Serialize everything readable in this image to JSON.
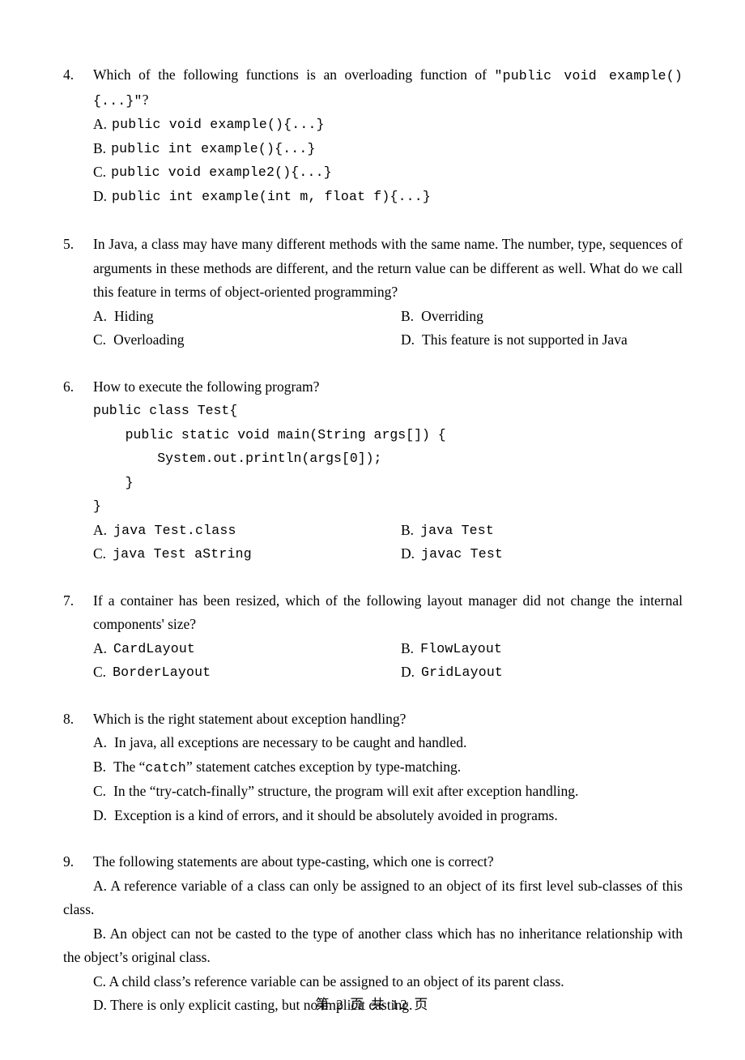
{
  "document": {
    "footer": "第 2 页 共 12 页",
    "page_number": 2,
    "total_pages": 12
  },
  "questions": [
    {
      "number": "4.",
      "stem_prefix": "Which of the following functions is an overloading function of ",
      "stem_code": "\"public void example(){...}\"",
      "stem_suffix": "?",
      "options": [
        {
          "label": "A.",
          "text": "public void example(){...}"
        },
        {
          "label": "B.",
          "text": "public int example(){...}"
        },
        {
          "label": "C.",
          "text": "public void example2(){...}"
        },
        {
          "label": "D.",
          "text": "public int example(int m, float f){...}"
        }
      ]
    },
    {
      "number": "5.",
      "stem": "In Java, a class may have many different methods with the same name. The number, type, sequences of arguments in these methods are different, and the return value can be different as well. What do we call this feature in terms of object-oriented programming?",
      "options": [
        {
          "label": "A.",
          "text": "Hiding"
        },
        {
          "label": "B.",
          "text": "Overriding"
        },
        {
          "label": "C.",
          "text": "Overloading"
        },
        {
          "label": "D.",
          "text": "This feature is not supported in Java"
        }
      ]
    },
    {
      "number": "6.",
      "stem": "How to execute the following program?",
      "code": "public class Test{\n    public static void main(String args[]) {\n        System.out.println(args[0]);\n    }\n}",
      "options": [
        {
          "label": "A.",
          "text": "java Test.class"
        },
        {
          "label": "B.",
          "text": "java Test"
        },
        {
          "label": "C.",
          "text": "java Test aString"
        },
        {
          "label": "D.",
          "text": "javac Test"
        }
      ]
    },
    {
      "number": "7.",
      "stem": "If a container has been resized, which of the following layout manager did not change the internal components' size?",
      "options": [
        {
          "label": "A.",
          "text": "CardLayout"
        },
        {
          "label": "B.",
          "text": "FlowLayout"
        },
        {
          "label": "C.",
          "text": "BorderLayout"
        },
        {
          "label": "D.",
          "text": "GridLayout"
        }
      ]
    },
    {
      "number": "8.",
      "stem": "Which is the right statement about exception handling?",
      "options": [
        {
          "label": "A.",
          "text": "In java, all exceptions are necessary to be caught and handled."
        },
        {
          "label": "B.",
          "pre": "The “",
          "code": "catch",
          "post": "”  statement catches exception by type-matching."
        },
        {
          "label": "C.",
          "text": "In the “try-catch-finally” structure, the program will exit after exception handling."
        },
        {
          "label": "D.",
          "text": "Exception is a kind of errors, and it should be absolutely avoided in programs."
        }
      ]
    },
    {
      "number": "9.",
      "stem": "The following statements are about type-casting, which one is correct?",
      "options": [
        {
          "label": "A.",
          "text": "A.  A reference variable of a class can only be assigned to an object of its first level sub-classes of this class."
        },
        {
          "label": "B.",
          "text": "B.  An object can not be casted to the type of another class which has no inheritance relationship with the object’s original class."
        },
        {
          "label": "C.",
          "text": "C.  A child class’s reference variable can be assigned to an object of its parent class."
        },
        {
          "label": "D.",
          "text": "D.  There is only explicit casting, but no implicit casting."
        }
      ]
    }
  ]
}
